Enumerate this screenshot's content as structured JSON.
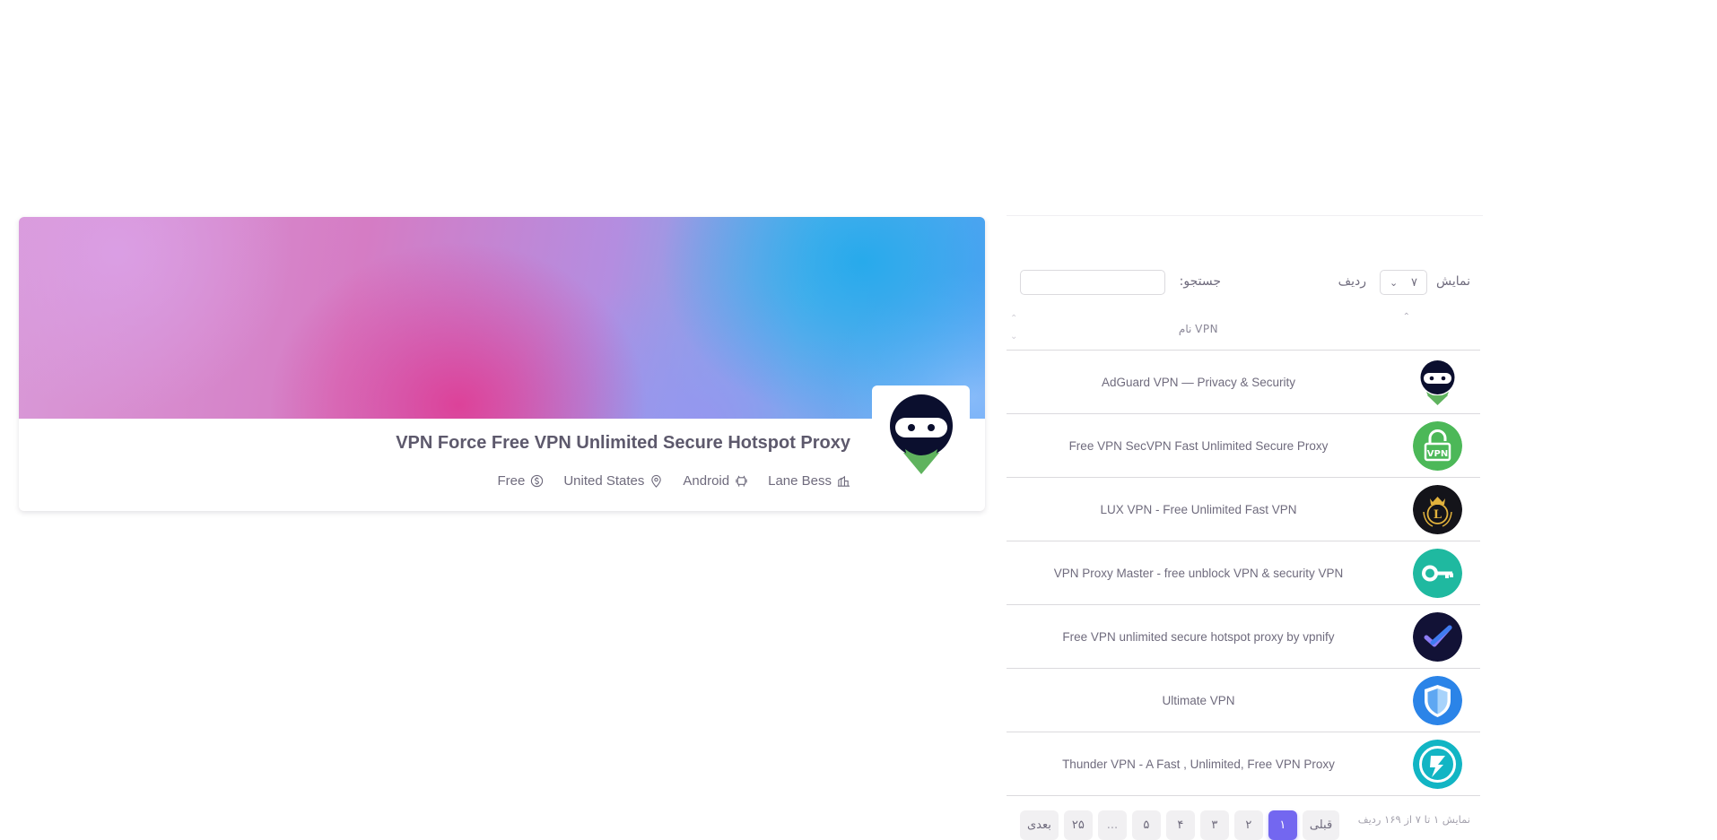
{
  "profile": {
    "title": "VPN Force Free VPN Unlimited Secure Hotspot Proxy",
    "meta": [
      {
        "icon": "developer-icon",
        "text": "Lane Bess"
      },
      {
        "icon": "android-icon",
        "text": "Android"
      },
      {
        "icon": "location-pin-icon",
        "text": "United States"
      },
      {
        "icon": "dollar-icon",
        "text": "Free"
      }
    ]
  },
  "table": {
    "show_label": "نمایش",
    "rows_value": "۷",
    "rows_label": "ردیف",
    "search_label": "جستجو:",
    "search_value": "",
    "column_header": "نام VPN",
    "rows": [
      {
        "name": "AdGuard VPN — Privacy & Security",
        "logo": "ninja-logo-icon"
      },
      {
        "name": "Free VPN SecVPN Fast Unlimited Secure Proxy",
        "logo": "vpn-lock-icon"
      },
      {
        "name": "LUX VPN - Free Unlimited Fast VPN",
        "logo": "lux-crown-icon"
      },
      {
        "name": "VPN Proxy Master - free unblock VPN & security VPN",
        "logo": "key-icon"
      },
      {
        "name": "Free VPN unlimited secure hotspot proxy by vpnify",
        "logo": "checkmark-icon"
      },
      {
        "name": "Ultimate VPN",
        "logo": "shield-icon"
      },
      {
        "name": "Thunder VPN - A Fast , Unlimited, Free VPN Proxy",
        "logo": "lightning-icon"
      }
    ],
    "info": "نمایش ۱ تا ۷ از ۱۶۹ ردیف",
    "pagination": {
      "prev": "قبلی",
      "pages": [
        "۱",
        "۲",
        "۳",
        "۴",
        "۵"
      ],
      "ellipsis": "...",
      "last": "۲۵",
      "next": "بعدی",
      "current": "۱"
    }
  },
  "colors": {
    "accent": "#7367f0",
    "text": "#6f6b7d",
    "title": "#5d596c"
  }
}
